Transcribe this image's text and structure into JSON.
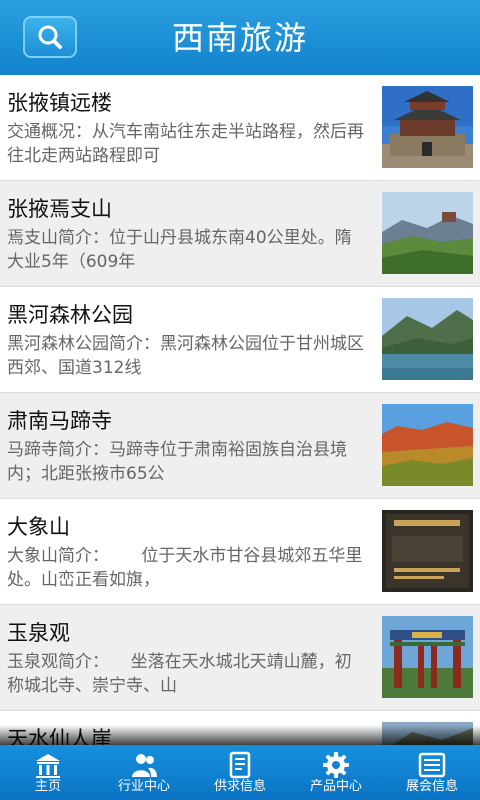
{
  "header": {
    "title": "西南旅游",
    "search_icon": "search-icon"
  },
  "items": [
    {
      "title": "张掖镇远楼",
      "desc": "交通概况：从汽车南站往东走半站路程，然后再往北走两站路程即可",
      "thumb": "tower-photo"
    },
    {
      "title": "张掖焉支山",
      "desc": "焉支山简介：位于山丹县城东南40公里处。隋大业5年（609年",
      "thumb": "mountain-photo"
    },
    {
      "title": "黑河森林公园",
      "desc": "黑河森林公园简介：黑河森林公园位于甘州城区西郊、国道312线",
      "thumb": "lake-photo"
    },
    {
      "title": "肃南马蹄寺",
      "desc": "马蹄寺简介：马蹄寺位于肃南裕固族自治县境内；北距张掖市65公",
      "thumb": "cliff-photo"
    },
    {
      "title": "大象山",
      "desc": "大象山简介：      位于天水市甘谷县城郊五华里处。山峦正看如旗，",
      "thumb": "stone-tablet-photo"
    },
    {
      "title": "玉泉观",
      "desc": "玉泉观简介：    坐落在天水城北天靖山麓，初称城北寺、崇宁寺、山",
      "thumb": "temple-gate-photo"
    },
    {
      "title": "天水仙人崖",
      "desc": "",
      "thumb": "cliff-temple-photo"
    }
  ],
  "tabs": [
    {
      "label": "主页",
      "icon": "home-icon"
    },
    {
      "label": "行业中心",
      "icon": "people-icon"
    },
    {
      "label": "供求信息",
      "icon": "document-icon"
    },
    {
      "label": "产品中心",
      "icon": "gear-icon"
    },
    {
      "label": "展会信息",
      "icon": "list-icon"
    }
  ],
  "colors": {
    "header": "#1b8fd8",
    "tabbar": "#1183cf",
    "alt_row": "#efefef"
  }
}
